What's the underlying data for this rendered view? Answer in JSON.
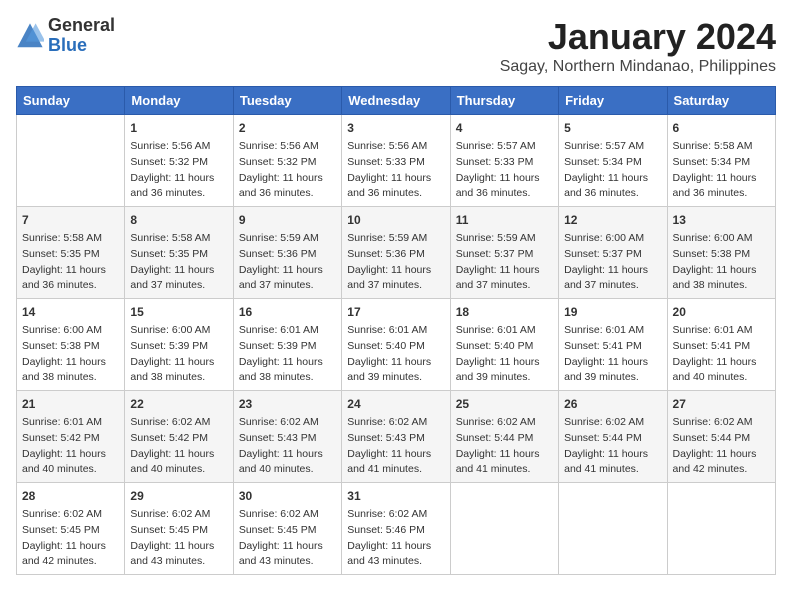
{
  "logo": {
    "general": "General",
    "blue": "Blue"
  },
  "title": "January 2024",
  "location": "Sagay, Northern Mindanao, Philippines",
  "days_header": [
    "Sunday",
    "Monday",
    "Tuesday",
    "Wednesday",
    "Thursday",
    "Friday",
    "Saturday"
  ],
  "weeks": [
    [
      {
        "day": "",
        "info": ""
      },
      {
        "day": "1",
        "info": "Sunrise: 5:56 AM\nSunset: 5:32 PM\nDaylight: 11 hours\nand 36 minutes."
      },
      {
        "day": "2",
        "info": "Sunrise: 5:56 AM\nSunset: 5:32 PM\nDaylight: 11 hours\nand 36 minutes."
      },
      {
        "day": "3",
        "info": "Sunrise: 5:56 AM\nSunset: 5:33 PM\nDaylight: 11 hours\nand 36 minutes."
      },
      {
        "day": "4",
        "info": "Sunrise: 5:57 AM\nSunset: 5:33 PM\nDaylight: 11 hours\nand 36 minutes."
      },
      {
        "day": "5",
        "info": "Sunrise: 5:57 AM\nSunset: 5:34 PM\nDaylight: 11 hours\nand 36 minutes."
      },
      {
        "day": "6",
        "info": "Sunrise: 5:58 AM\nSunset: 5:34 PM\nDaylight: 11 hours\nand 36 minutes."
      }
    ],
    [
      {
        "day": "7",
        "info": "Sunrise: 5:58 AM\nSunset: 5:35 PM\nDaylight: 11 hours\nand 36 minutes."
      },
      {
        "day": "8",
        "info": "Sunrise: 5:58 AM\nSunset: 5:35 PM\nDaylight: 11 hours\nand 37 minutes."
      },
      {
        "day": "9",
        "info": "Sunrise: 5:59 AM\nSunset: 5:36 PM\nDaylight: 11 hours\nand 37 minutes."
      },
      {
        "day": "10",
        "info": "Sunrise: 5:59 AM\nSunset: 5:36 PM\nDaylight: 11 hours\nand 37 minutes."
      },
      {
        "day": "11",
        "info": "Sunrise: 5:59 AM\nSunset: 5:37 PM\nDaylight: 11 hours\nand 37 minutes."
      },
      {
        "day": "12",
        "info": "Sunrise: 6:00 AM\nSunset: 5:37 PM\nDaylight: 11 hours\nand 37 minutes."
      },
      {
        "day": "13",
        "info": "Sunrise: 6:00 AM\nSunset: 5:38 PM\nDaylight: 11 hours\nand 38 minutes."
      }
    ],
    [
      {
        "day": "14",
        "info": "Sunrise: 6:00 AM\nSunset: 5:38 PM\nDaylight: 11 hours\nand 38 minutes."
      },
      {
        "day": "15",
        "info": "Sunrise: 6:00 AM\nSunset: 5:39 PM\nDaylight: 11 hours\nand 38 minutes."
      },
      {
        "day": "16",
        "info": "Sunrise: 6:01 AM\nSunset: 5:39 PM\nDaylight: 11 hours\nand 38 minutes."
      },
      {
        "day": "17",
        "info": "Sunrise: 6:01 AM\nSunset: 5:40 PM\nDaylight: 11 hours\nand 39 minutes."
      },
      {
        "day": "18",
        "info": "Sunrise: 6:01 AM\nSunset: 5:40 PM\nDaylight: 11 hours\nand 39 minutes."
      },
      {
        "day": "19",
        "info": "Sunrise: 6:01 AM\nSunset: 5:41 PM\nDaylight: 11 hours\nand 39 minutes."
      },
      {
        "day": "20",
        "info": "Sunrise: 6:01 AM\nSunset: 5:41 PM\nDaylight: 11 hours\nand 40 minutes."
      }
    ],
    [
      {
        "day": "21",
        "info": "Sunrise: 6:01 AM\nSunset: 5:42 PM\nDaylight: 11 hours\nand 40 minutes."
      },
      {
        "day": "22",
        "info": "Sunrise: 6:02 AM\nSunset: 5:42 PM\nDaylight: 11 hours\nand 40 minutes."
      },
      {
        "day": "23",
        "info": "Sunrise: 6:02 AM\nSunset: 5:43 PM\nDaylight: 11 hours\nand 40 minutes."
      },
      {
        "day": "24",
        "info": "Sunrise: 6:02 AM\nSunset: 5:43 PM\nDaylight: 11 hours\nand 41 minutes."
      },
      {
        "day": "25",
        "info": "Sunrise: 6:02 AM\nSunset: 5:44 PM\nDaylight: 11 hours\nand 41 minutes."
      },
      {
        "day": "26",
        "info": "Sunrise: 6:02 AM\nSunset: 5:44 PM\nDaylight: 11 hours\nand 41 minutes."
      },
      {
        "day": "27",
        "info": "Sunrise: 6:02 AM\nSunset: 5:44 PM\nDaylight: 11 hours\nand 42 minutes."
      }
    ],
    [
      {
        "day": "28",
        "info": "Sunrise: 6:02 AM\nSunset: 5:45 PM\nDaylight: 11 hours\nand 42 minutes."
      },
      {
        "day": "29",
        "info": "Sunrise: 6:02 AM\nSunset: 5:45 PM\nDaylight: 11 hours\nand 43 minutes."
      },
      {
        "day": "30",
        "info": "Sunrise: 6:02 AM\nSunset: 5:45 PM\nDaylight: 11 hours\nand 43 minutes."
      },
      {
        "day": "31",
        "info": "Sunrise: 6:02 AM\nSunset: 5:46 PM\nDaylight: 11 hours\nand 43 minutes."
      },
      {
        "day": "",
        "info": ""
      },
      {
        "day": "",
        "info": ""
      },
      {
        "day": "",
        "info": ""
      }
    ]
  ]
}
